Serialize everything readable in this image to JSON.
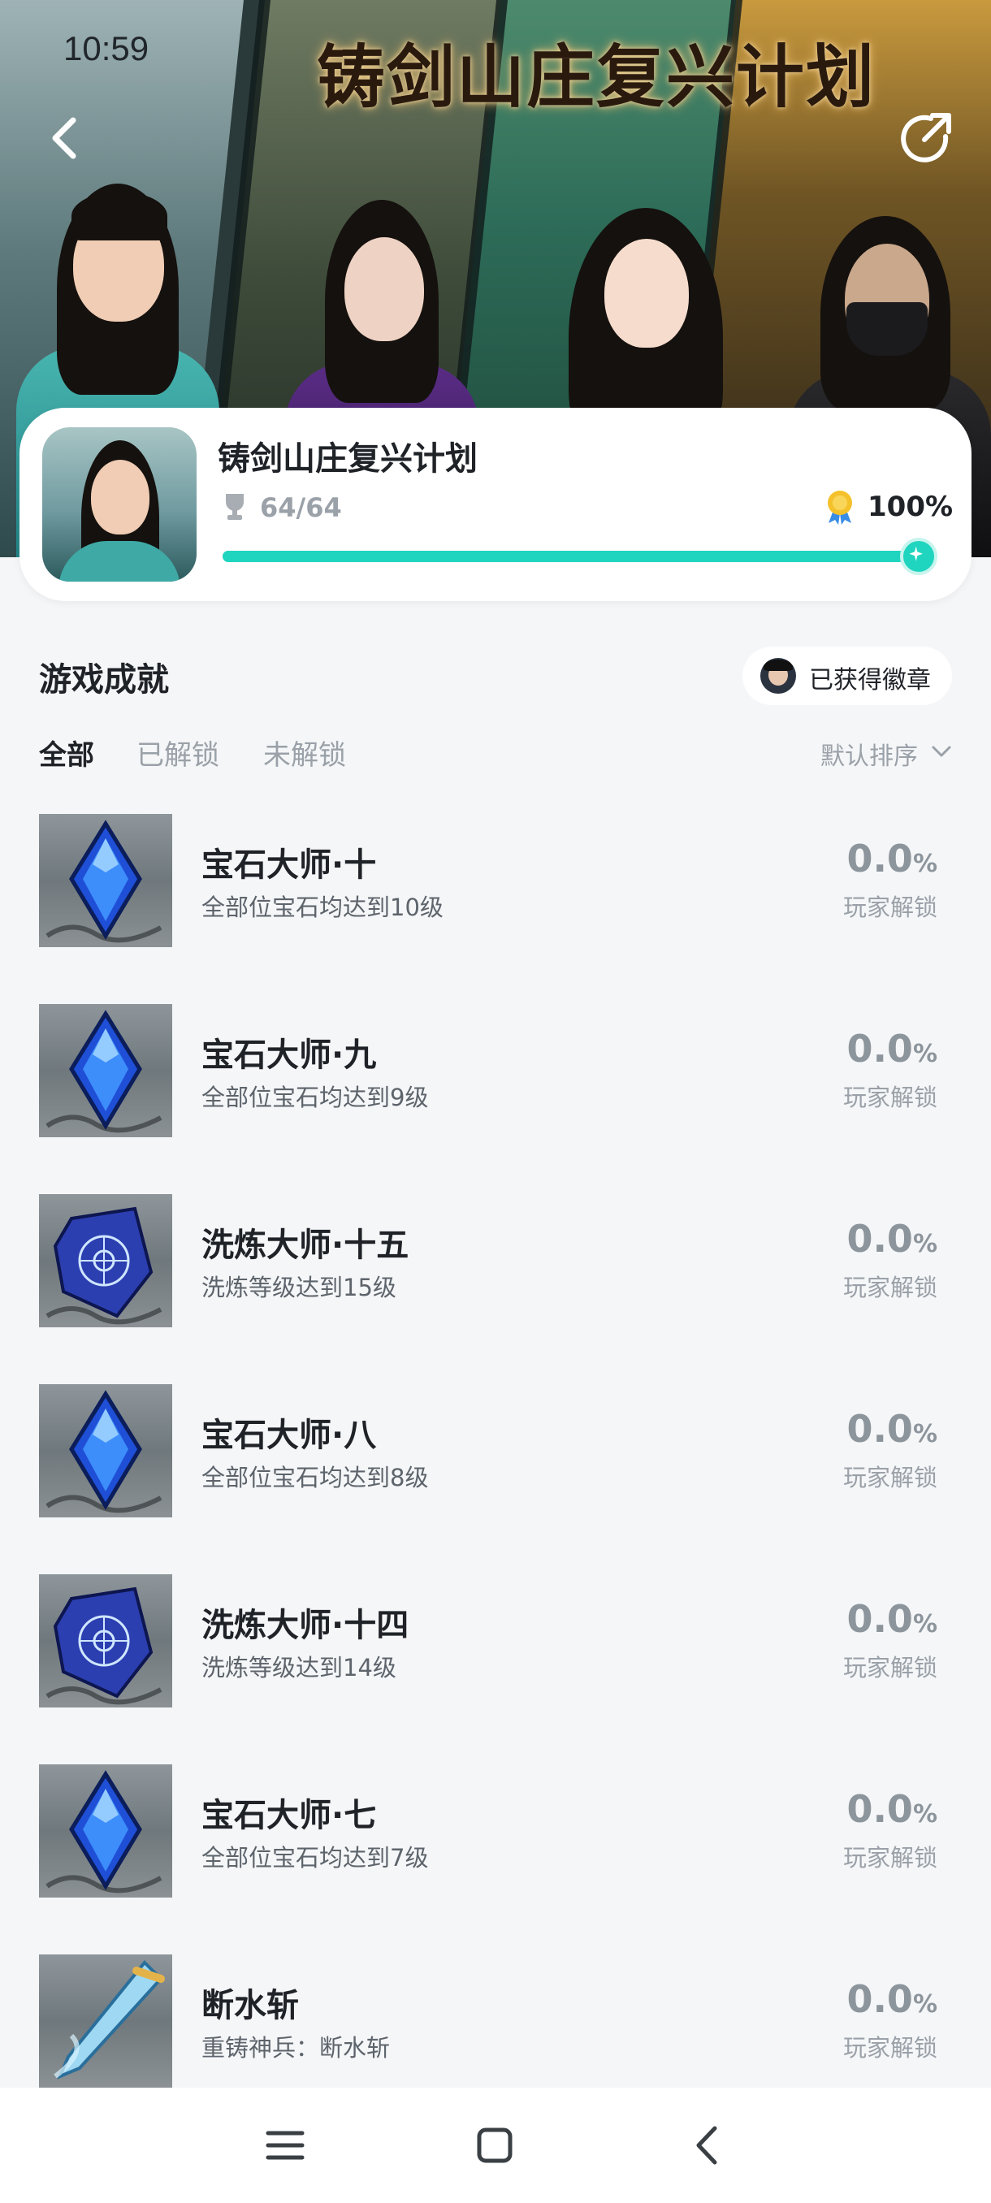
{
  "status_bar": {
    "time": "10:59"
  },
  "hero": {
    "title": "铸剑山庄复兴计划"
  },
  "game_card": {
    "name": "铸剑山庄复兴计划",
    "achievement_count": "64/64",
    "completion_percent": "100%",
    "progress_fraction": 1.0,
    "accent_color": "#20d5bf"
  },
  "section": {
    "title": "游戏成就",
    "badge_button": "已获得徽章"
  },
  "tabs": {
    "all": "全部",
    "unlocked": "已解锁",
    "locked": "未解锁",
    "sort": "默认排序"
  },
  "achievements": [
    {
      "title": "宝石大师·十",
      "desc": "全部位宝石均达到10级",
      "rate": "0.0",
      "unit": "%",
      "sub": "玩家解锁",
      "icon": "gem-icon"
    },
    {
      "title": "宝石大师·九",
      "desc": "全部位宝石均达到9级",
      "rate": "0.0",
      "unit": "%",
      "sub": "玩家解锁",
      "icon": "gem-icon"
    },
    {
      "title": "洗炼大师·十五",
      "desc": "洗炼等级达到15级",
      "rate": "0.0",
      "unit": "%",
      "sub": "玩家解锁",
      "icon": "rune-crystal-icon"
    },
    {
      "title": "宝石大师·八",
      "desc": "全部位宝石均达到8级",
      "rate": "0.0",
      "unit": "%",
      "sub": "玩家解锁",
      "icon": "gem-icon"
    },
    {
      "title": "洗炼大师·十四",
      "desc": "洗炼等级达到14级",
      "rate": "0.0",
      "unit": "%",
      "sub": "玩家解锁",
      "icon": "rune-crystal-icon"
    },
    {
      "title": "宝石大师·七",
      "desc": "全部位宝石均达到7级",
      "rate": "0.0",
      "unit": "%",
      "sub": "玩家解锁",
      "icon": "gem-icon"
    },
    {
      "title": "断水斩",
      "desc": "重铸神兵：断水斩",
      "rate": "0.0",
      "unit": "%",
      "sub": "玩家解锁",
      "icon": "sword-icon"
    }
  ],
  "nav": {
    "icons": [
      "menu-icon",
      "home-icon",
      "back-icon"
    ]
  }
}
